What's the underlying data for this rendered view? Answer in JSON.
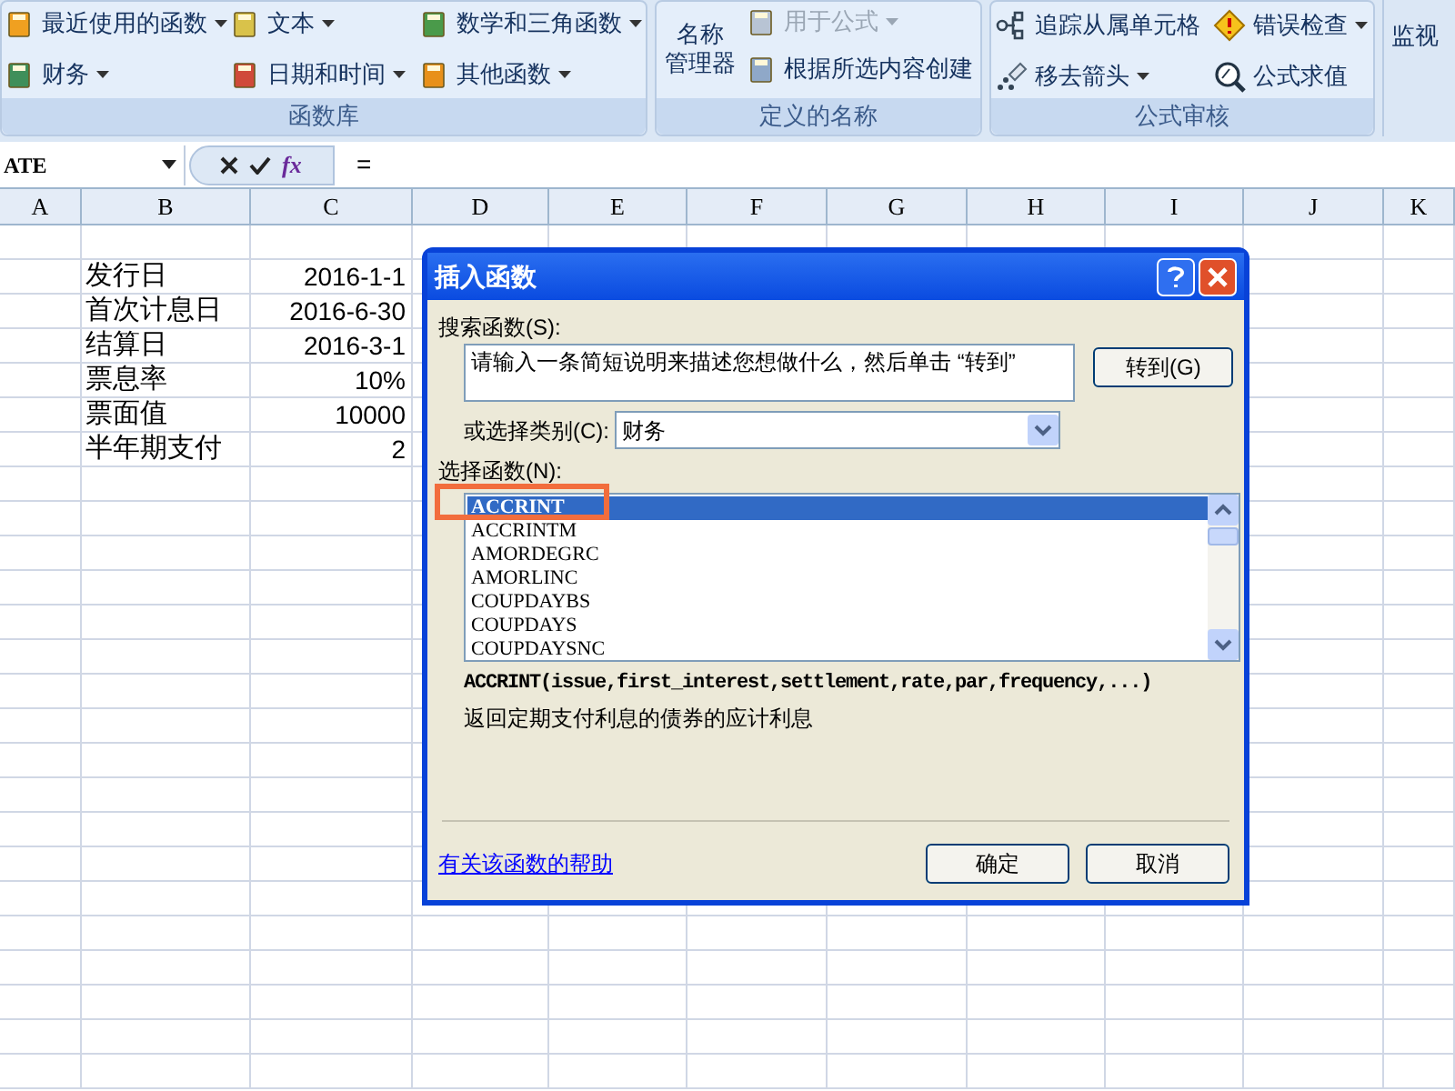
{
  "ribbon": {
    "groups": [
      {
        "label": "函数库",
        "items": [
          {
            "label": "最近使用的函数",
            "dropdown": true,
            "disabled": false
          },
          {
            "label": "文本",
            "dropdown": true,
            "disabled": false
          },
          {
            "label": "数学和三角函数",
            "dropdown": true,
            "disabled": false
          },
          {
            "label": "财务",
            "dropdown": true,
            "disabled": false
          },
          {
            "label": "日期和时间",
            "dropdown": true,
            "disabled": false
          },
          {
            "label": "其他函数",
            "dropdown": true,
            "disabled": false
          }
        ]
      },
      {
        "label": "定义的名称",
        "big_button": {
          "label_lines": [
            "名称",
            "管理器"
          ]
        },
        "items": [
          {
            "label": "用于公式",
            "dropdown": true,
            "disabled": true
          },
          {
            "label": "根据所选内容创建",
            "dropdown": false,
            "disabled": false
          }
        ]
      },
      {
        "label": "公式审核",
        "items": [
          {
            "label": "追踪从属单元格",
            "dropdown": false,
            "disabled": false
          },
          {
            "label": "错误检查",
            "dropdown": true,
            "disabled": false
          },
          {
            "label": "移去箭头",
            "dropdown": true,
            "disabled": false
          },
          {
            "label": "公式求值",
            "dropdown": false,
            "disabled": false
          }
        ]
      },
      {
        "items": [
          {
            "label": "监视",
            "dropdown": false,
            "disabled": false
          }
        ]
      }
    ]
  },
  "formula_bar": {
    "name_box": "ATE",
    "fx": "fx",
    "formula": "="
  },
  "sheet": {
    "columns": [
      "A",
      "B",
      "C",
      "D",
      "E",
      "F",
      "G",
      "H",
      "I",
      "J",
      "K"
    ],
    "rows": [
      {
        "label": "发行日",
        "value": "2016-1-1"
      },
      {
        "label": "首次计息日",
        "value": "2016-6-30"
      },
      {
        "label": "结算日",
        "value": "2016-3-1"
      },
      {
        "label": "票息率",
        "value": "10%"
      },
      {
        "label": "票面值",
        "value": "10000"
      },
      {
        "label": "半年期支付",
        "value": "2"
      }
    ]
  },
  "dialog": {
    "title": "插入函数",
    "search_label": "搜索函数(S):",
    "search_value": "请输入一条简短说明来描述您想做什么，然后单击 “转到”",
    "go_button": "转到(G)",
    "category_label": "或选择类别(C):",
    "category_value": "财务",
    "function_label": "选择函数(N):",
    "functions": [
      {
        "name": "ACCRINT",
        "selected": true
      },
      {
        "name": "ACCRINTM",
        "selected": false
      },
      {
        "name": "AMORDEGRC",
        "selected": false
      },
      {
        "name": "AMORLINC",
        "selected": false
      },
      {
        "name": "COUPDAYBS",
        "selected": false
      },
      {
        "name": "COUPDAYS",
        "selected": false
      },
      {
        "name": "COUPDAYSNC",
        "selected": false
      }
    ],
    "signature": "ACCRINT(issue,first_interest,settlement,rate,par,frequency,...)",
    "description": "返回定期支付利息的债券的应计利息",
    "help_link": "有关该函数的帮助",
    "ok_button": "确定",
    "cancel_button": "取消"
  }
}
